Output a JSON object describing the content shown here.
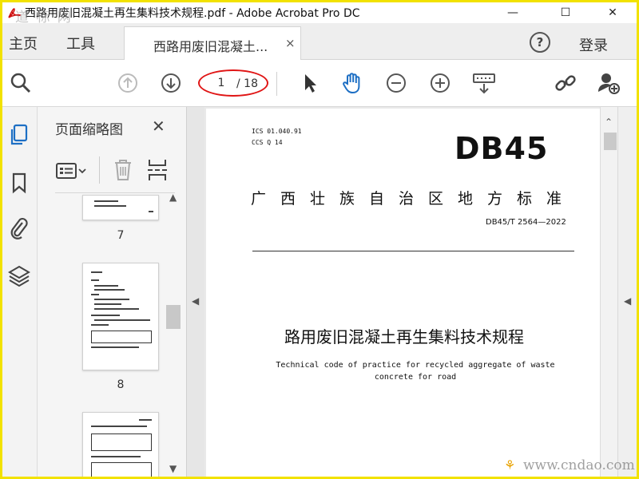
{
  "window": {
    "title": "西路用废旧混凝土再生集料技术规程.pdf - Adobe Acrobat Pro DC",
    "watermark_top": "道 标 网",
    "minimize": "—",
    "maximize": "☐",
    "close": "✕"
  },
  "tabs": {
    "home": "主页",
    "tools": "工具",
    "document": "西路用废旧混凝土...",
    "close": "×",
    "help": "?",
    "login": "登录"
  },
  "toolbar": {
    "page_current": "1",
    "page_total": "/ 18"
  },
  "thumbs": {
    "title": "页面缩略图",
    "close": "✕",
    "pages": [
      "7",
      "8"
    ]
  },
  "document": {
    "ics": "ICS  01.040.91",
    "ccs": "CCS Q 14",
    "logo": "DB45",
    "region": "广西壮族自治区地方标准",
    "standard_no": "DB45/T 2564—2022",
    "title_cn": "路用废旧混凝土再生集料技术规程",
    "title_en": "Technical code of practice for recycled aggregate of waste concrete for road"
  },
  "footer": {
    "watermark": "www.cndao.com"
  },
  "colors": {
    "frame": "#f2e200",
    "accent_blue": "#1d6fc4",
    "highlight_red": "#e01515"
  }
}
